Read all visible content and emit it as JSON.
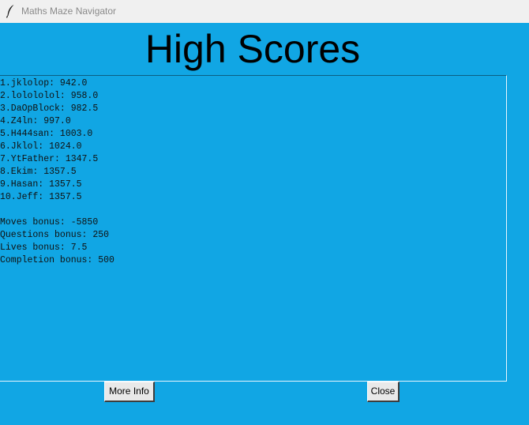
{
  "window": {
    "title": "Maths Maze Navigator",
    "icon": "feather-icon"
  },
  "heading": "High Scores",
  "scores": [
    "1.jklolop: 942.0",
    "2.lolololol: 958.0",
    "3.DaOpBlock: 982.5",
    "4.Z4ln: 997.0",
    "5.H444san: 1003.0",
    "6.Jklol: 1024.0",
    "7.YtFather: 1347.5",
    "8.Ekim: 1357.5",
    "9.Hasan: 1357.5",
    "10.Jeff: 1357.5"
  ],
  "bonuses": [
    "Moves bonus: -5850",
    "Questions bonus: 250",
    "Lives bonus: 7.5",
    "Completion bonus: 500"
  ],
  "buttons": {
    "more_info": "More Info",
    "close": "Close"
  },
  "colors": {
    "background": "#11a6e4",
    "titlebar": "#f0f0f0",
    "button": "#e9e9e9"
  }
}
